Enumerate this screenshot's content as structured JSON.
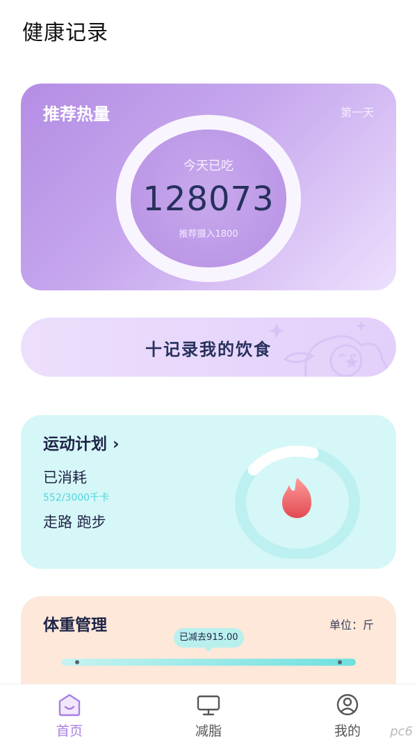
{
  "header": {
    "title": "健康记录"
  },
  "calories": {
    "title": "推荐热量",
    "day": "第一天",
    "eaten_label": "今天已吃",
    "eaten_value": "128073",
    "recommend": "推荐摄入1800"
  },
  "record": {
    "label": "十记录我的饮食"
  },
  "exercise": {
    "title": "运动计划 ›",
    "burned_label": "已消耗",
    "progress": "552/3000千卡",
    "progress_fraction": 0.184,
    "activities": "走路 跑步",
    "accent": "#4fd6df"
  },
  "weight": {
    "title": "体重管理",
    "unit": "单位：斤",
    "reduced": "已减去915.00"
  },
  "nav": {
    "items": [
      {
        "label": "首页",
        "icon": "home-icon"
      },
      {
        "label": "减脂",
        "icon": "monitor-icon"
      },
      {
        "label": "我的",
        "icon": "profile-icon"
      }
    ],
    "active_color": "#a77fe0"
  },
  "watermark": "pc6"
}
